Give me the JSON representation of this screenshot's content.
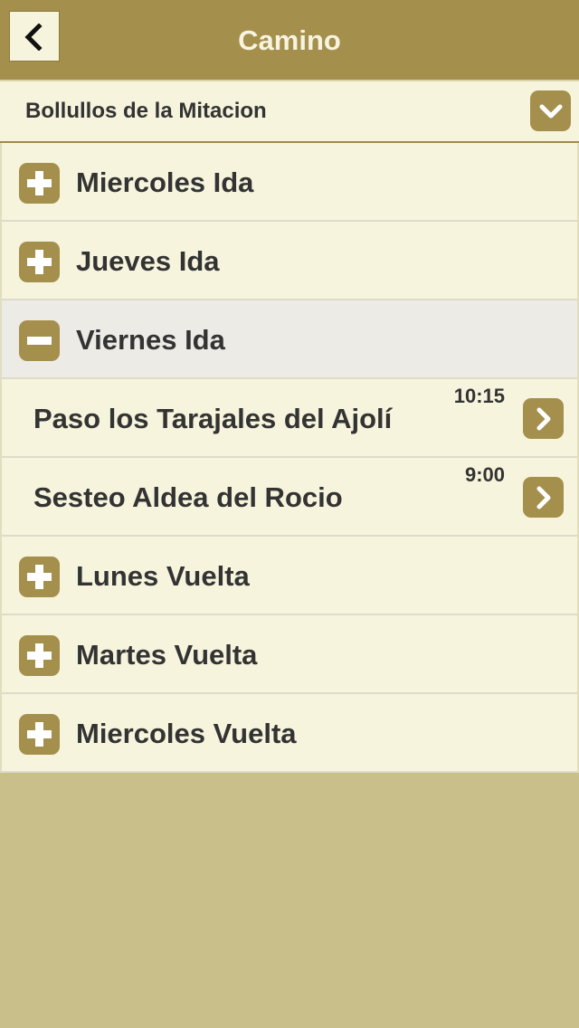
{
  "header": {
    "title": "Camino",
    "back_icon": "chevron-left-icon"
  },
  "selector": {
    "value": "Bollullos de la Mitacion",
    "icon": "chevron-down-icon"
  },
  "colors": {
    "accent": "#a48f4c",
    "row_bg": "#f6f4dc",
    "expanded_bg": "#ecebe6",
    "page_bg": "#c8bf8a"
  },
  "days": [
    {
      "label": "Miercoles Ida",
      "state": "collapsed"
    },
    {
      "label": "Jueves Ida",
      "state": "collapsed"
    },
    {
      "label": "Viernes Ida",
      "state": "expanded",
      "stops": [
        {
          "label": "Paso los Tarajales del Ajolí",
          "time": "10:15"
        },
        {
          "label": "Sesteo Aldea del Rocio",
          "time": "9:00"
        }
      ]
    },
    {
      "label": "Lunes Vuelta",
      "state": "collapsed"
    },
    {
      "label": "Martes Vuelta",
      "state": "collapsed"
    },
    {
      "label": "Miercoles Vuelta",
      "state": "collapsed"
    }
  ]
}
